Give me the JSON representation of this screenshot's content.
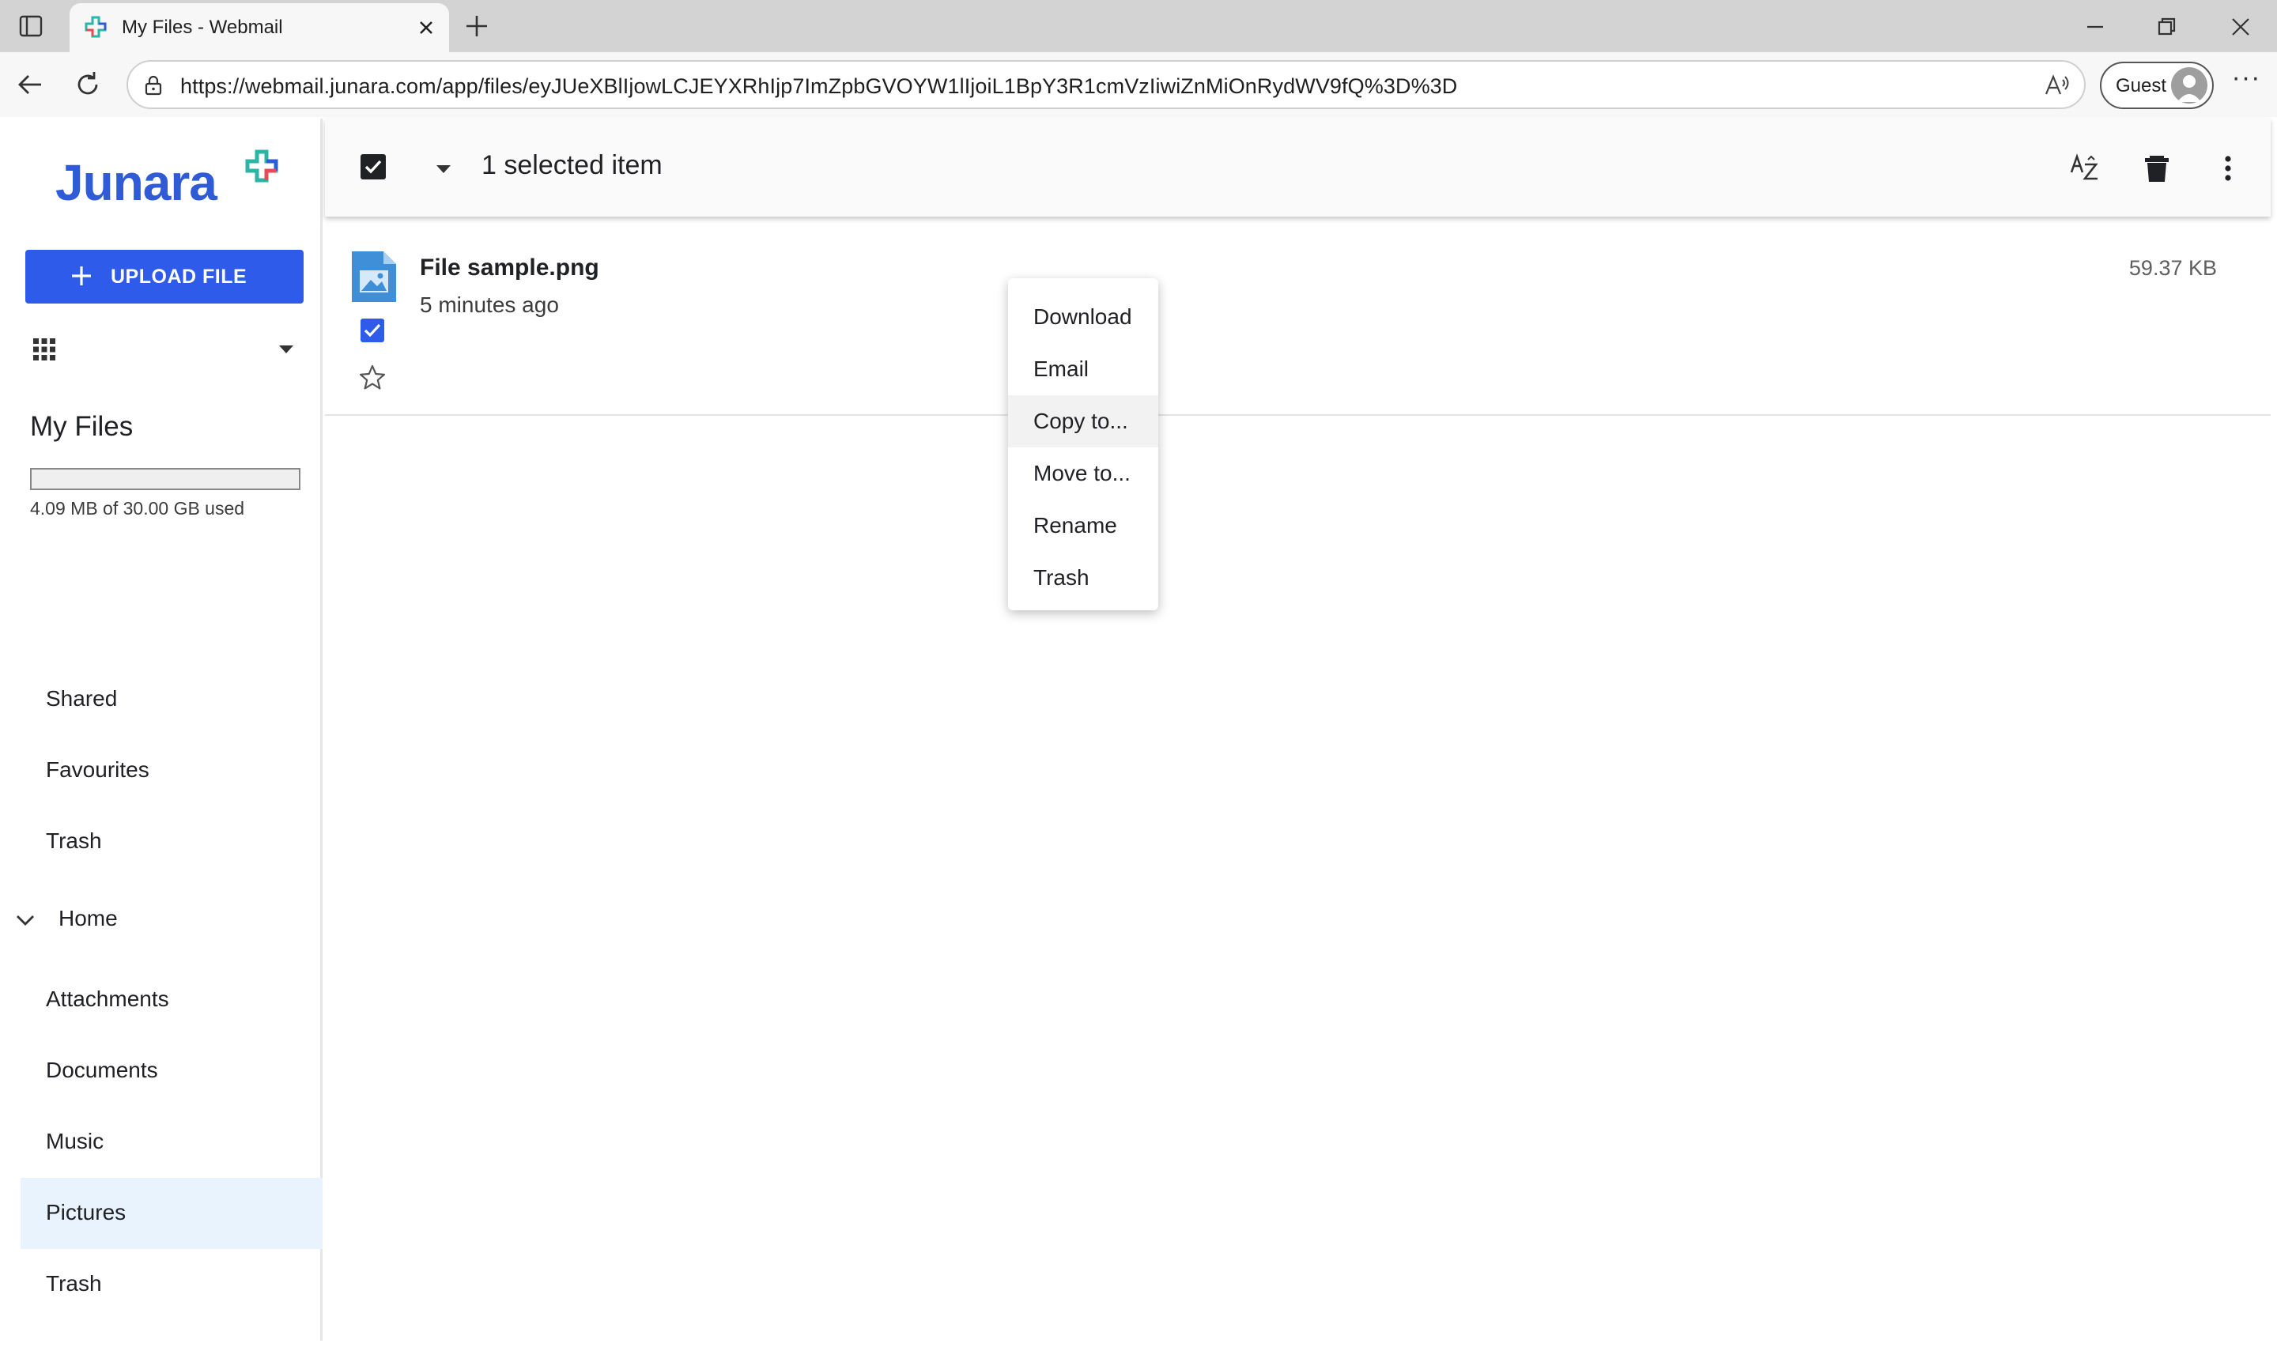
{
  "browser": {
    "tab_title": "My Files - Webmail",
    "url": "https://webmail.junara.com/app/files/eyJUeXBlIjowLCJEYXRhIjp7ImZpbGVOYW1lIjoiL1BpY3R1cmVzIiwiZnMiOnRydWV9fQ%3D%3D",
    "profile_label": "Guest",
    "more_label": "···"
  },
  "sidebar": {
    "logo_text": "Junara",
    "upload_label": "UPLOAD FILE",
    "section_title": "My Files",
    "quota_text": "4.09 MB of 30.00 GB used",
    "quota_fraction": 0.0001,
    "top_items": [
      {
        "label": "Shared"
      },
      {
        "label": "Favourites"
      },
      {
        "label": "Trash"
      }
    ],
    "home_label": "Home",
    "home_items": [
      {
        "label": "Attachments"
      },
      {
        "label": "Documents"
      },
      {
        "label": "Music"
      },
      {
        "label": "Pictures",
        "active": true
      },
      {
        "label": "Trash"
      }
    ]
  },
  "selection_bar": {
    "count_text": "1 selected item"
  },
  "file": {
    "name": "File sample.png",
    "modified": "5 minutes ago",
    "size": "59.37 KB"
  },
  "context_menu": {
    "items": [
      "Download",
      "Email",
      "Copy to...",
      "Move to...",
      "Rename",
      "Trash"
    ],
    "hovered_index": 2
  },
  "colors": {
    "accent": "#2f5bea",
    "active_nav": "#e8f3fd",
    "logo_blue": "#2f5bd6",
    "logo_teal": "#2bb5a6",
    "logo_red": "#e84b55"
  }
}
